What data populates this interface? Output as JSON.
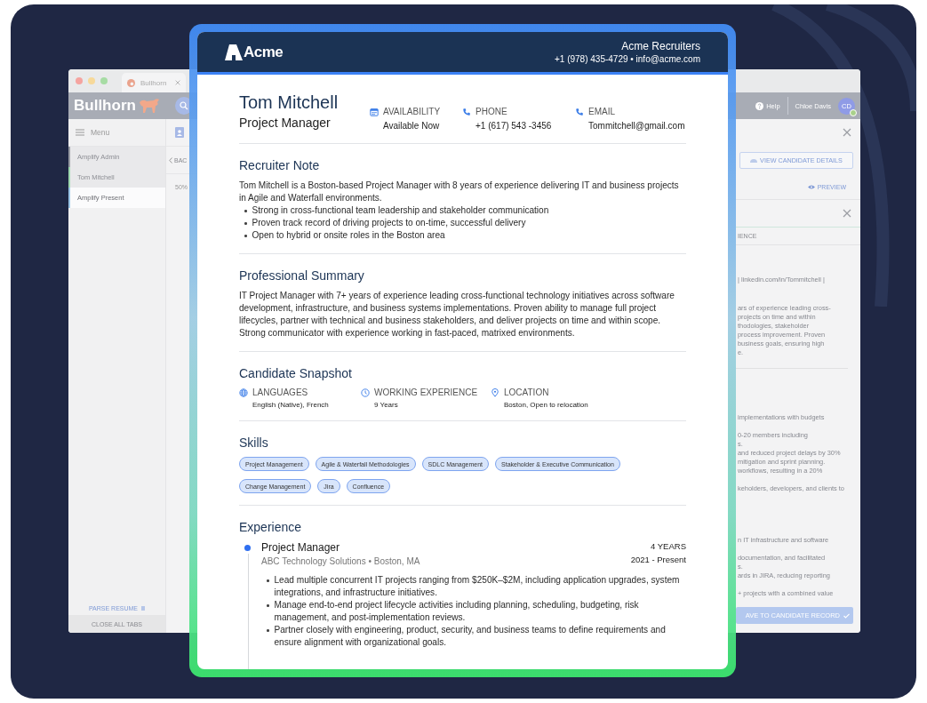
{
  "backdrop": {
    "browser_tab": {
      "title": "Bullhorn"
    },
    "app_header": {
      "logo": "Bullhorn",
      "help": "Help",
      "user": "Chloe Davis",
      "avatar": "CD"
    },
    "sidebar": {
      "menu": "Menu",
      "items": [
        {
          "label": "Amplify Admin",
          "color": "#9a9ea6",
          "selected": false
        },
        {
          "label": "Tom Mitchell",
          "color": "#9fd9b0",
          "selected": false
        },
        {
          "label": "Amplify Present",
          "color": "#9cc7e8",
          "selected": true
        }
      ],
      "parse_resume": "PARSE RESUME",
      "close_all_tabs": "CLOSE ALL TABS"
    },
    "workspace": {
      "back": "BAC",
      "zoom": "50%"
    },
    "panel": {
      "view_details": "VIEW CANDIDATE DETAILS",
      "preview": "PREVIEW",
      "tab": "IENCE",
      "upper_groups": [
        [
          "| linkedin.com/in/Tommitchell |"
        ],
        [
          "ars of experience leading cross-",
          "projects on time and within",
          "thodologies, stakeholder",
          "process improvement. Proven",
          "business goals, ensuring high",
          "e."
        ]
      ],
      "lower_groups": [
        [
          "implementations with budgets"
        ],
        [
          "0-20 members including",
          "s.",
          "and reduced project delays by 30%",
          "mitigation and sprint planning.",
          "workflows, resulting in a 20%"
        ],
        [
          "keholders, developers, and clients to"
        ]
      ],
      "bottom_groups": [
        [
          "n IT infrastructure and software"
        ],
        [
          "documentation, and facilitated",
          "s.",
          "ards in JIRA, reducing reporting"
        ],
        [
          "+ projects with a combined value"
        ]
      ],
      "save": "AVE TO CANDIDATE RECORD"
    }
  },
  "resume": {
    "header": {
      "logo": "Acme",
      "company": "Acme Recruiters",
      "contact": "+1 (978) 435-4729 • info@acme.com"
    },
    "name": "Tom Mitchell",
    "title": "Project Manager",
    "contacts": [
      {
        "kind": "calendar",
        "label": "AVAILABILITY",
        "value": "Available Now"
      },
      {
        "kind": "phone",
        "label": "PHONE",
        "value": "+1 (617) 543 -3456"
      },
      {
        "kind": "phone",
        "label": "EMAIL",
        "value": "Tommitchell@gmail.com"
      }
    ],
    "recruiter_note": {
      "heading": "Recruiter Note",
      "text": "Tom Mitchell is a Boston-based Project Manager with 8 years of experience delivering IT and business projects in Agile and Waterfall environments.",
      "bullets": [
        "Strong in cross-functional team leadership and stakeholder communication",
        "Proven track record of driving projects to on-time, successful delivery",
        "Open to hybrid or onsite roles in the Boston area"
      ]
    },
    "summary": {
      "heading": "Professional Summary",
      "text": "IT Project Manager with 7+ years of experience leading cross-functional technology initiatives across software development, infrastructure, and business systems implementations. Proven ability to manage full project lifecycles, partner with technical and business stakeholders, and deliver projects on time and within scope. Strong communicator with experience working in fast-paced, matrixed environments."
    },
    "snapshot": {
      "heading": "Candidate Snapshot",
      "items": [
        {
          "kind": "globe",
          "label": "LANGUAGES",
          "value": "English (Native), French"
        },
        {
          "kind": "clock",
          "label": "WORKING EXPERIENCE",
          "value": "9 Years"
        },
        {
          "kind": "pin",
          "label": "LOCATION",
          "value": "Boston, Open to relocation"
        }
      ]
    },
    "skills": {
      "heading": "Skills",
      "tags": [
        "Project Management",
        "Agile & Waterfall Methodologies",
        "SDLC Management",
        "Stakeholder & Executive Communication",
        "Change Management",
        "Jira",
        "Confluence"
      ]
    },
    "experience": {
      "heading": "Experience",
      "jobs": [
        {
          "role": "Project Manager",
          "company": "ABC Technology Solutions • Boston, MA",
          "duration": "4 YEARS",
          "dates": "2021 - Present",
          "bullets": [
            "Lead multiple concurrent IT projects ranging from $250K–$2M, including application upgrades, system integrations, and infrastructure initiatives.",
            "Manage end-to-end project lifecycle activities including planning, scheduling, budgeting, risk management, and post-implementation reviews.",
            "Partner closely with engineering, product, security, and business teams to define requirements and ensure alignment with organizational goals."
          ]
        }
      ]
    }
  }
}
